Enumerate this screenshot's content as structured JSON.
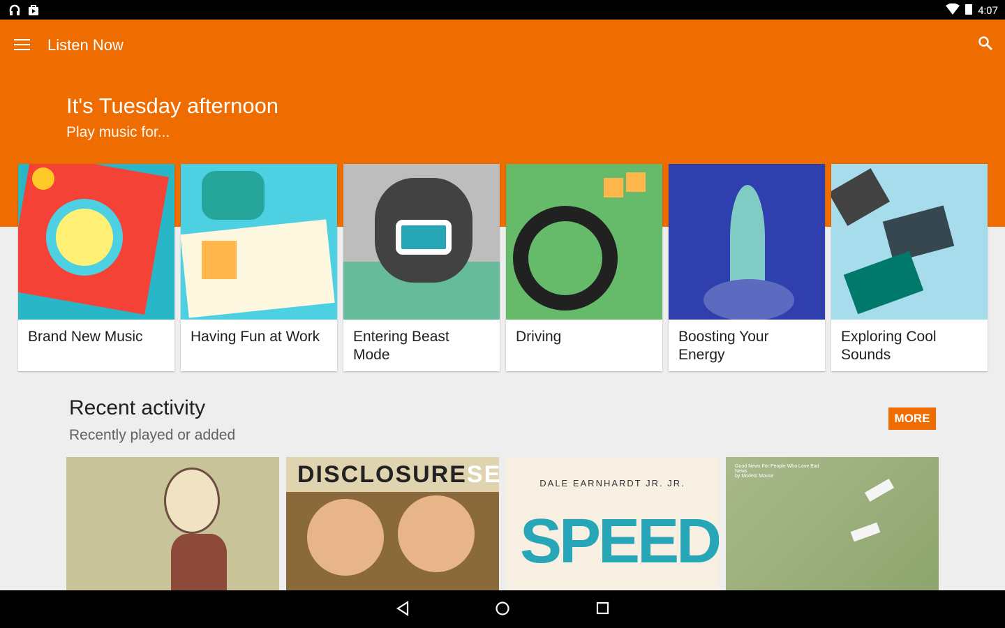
{
  "status_bar": {
    "time": "4:07",
    "left_icons": [
      "headphones-icon",
      "play-store-bag-icon"
    ],
    "right_icons": [
      "wifi-icon",
      "battery-icon"
    ]
  },
  "app_bar": {
    "title": "Listen Now",
    "menu_icon": "hamburger-menu-icon",
    "search_icon": "search-icon"
  },
  "colors": {
    "accent": "#ef6c00",
    "background": "#eeeeee"
  },
  "greeting": {
    "title": "It's Tuesday afternoon",
    "subtitle": "Play music for..."
  },
  "moods": [
    {
      "label": "Brand New Music",
      "color": "#29b6c6"
    },
    {
      "label": "Having Fun at Work",
      "color": "#4dd0e1"
    },
    {
      "label": "Entering Beast Mode",
      "color": "#bdbdbd"
    },
    {
      "label": "Driving",
      "color": "#66bb6a"
    },
    {
      "label": "Boosting Your Energy",
      "color": "#303fae"
    },
    {
      "label": "Exploring Cool Sounds",
      "color": "#a6dcec"
    }
  ],
  "recent": {
    "title": "Recent activity",
    "subtitle": "Recently played or added",
    "more_label": "MORE",
    "albums": [
      {
        "art_text": "",
        "color": "#c9c39a"
      },
      {
        "art_text": "DISCLOSURE SETTLE",
        "color": "#8a6a3a"
      },
      {
        "art_text": "DALE EARNHARDT JR. JR. SPEED",
        "color": "#f7efe2"
      },
      {
        "art_text": "Good News For People Who Love Bad News by Modest Mouse",
        "color": "#9db07a"
      }
    ]
  },
  "nav": {
    "back_icon": "back-icon",
    "home_icon": "home-icon",
    "recents_icon": "recents-icon"
  }
}
